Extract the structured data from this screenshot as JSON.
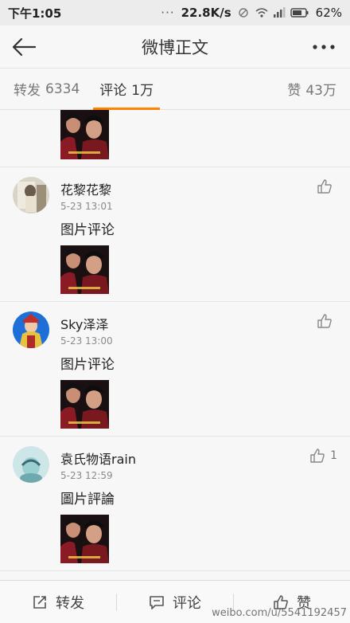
{
  "status_bar": {
    "time": "下午1:05",
    "dots": "···",
    "speed": "22.8K/s",
    "battery": "62%"
  },
  "nav": {
    "title": "微博正文"
  },
  "tabs": {
    "reposts_label": "转发",
    "reposts_count": "6334",
    "comments_label": "评论",
    "comments_count": "1万",
    "likes_label": "赞",
    "likes_count": "43万"
  },
  "comments": [
    {
      "name": "花黎花黎",
      "time": "5-23 13:01",
      "text": "图片评论",
      "likes": ""
    },
    {
      "name": "Sky泽泽",
      "time": "5-23 13:00",
      "text": "图片评论",
      "likes": ""
    },
    {
      "name": "袁氏物语rain",
      "time": "5-23 12:59",
      "text": "圖片評論",
      "likes": "1"
    }
  ],
  "bottom_bar": {
    "repost": "转发",
    "comment": "评论",
    "like": "赞"
  },
  "watermark": "weibo.com/u/5541192457",
  "icons": {
    "back": "back-arrow-icon",
    "more": "more-icon",
    "like": "thumbs-up-icon",
    "repost": "repost-icon",
    "comment": "comment-icon"
  },
  "colors": {
    "accent": "#ff8200",
    "background": "#f7f7f7"
  }
}
